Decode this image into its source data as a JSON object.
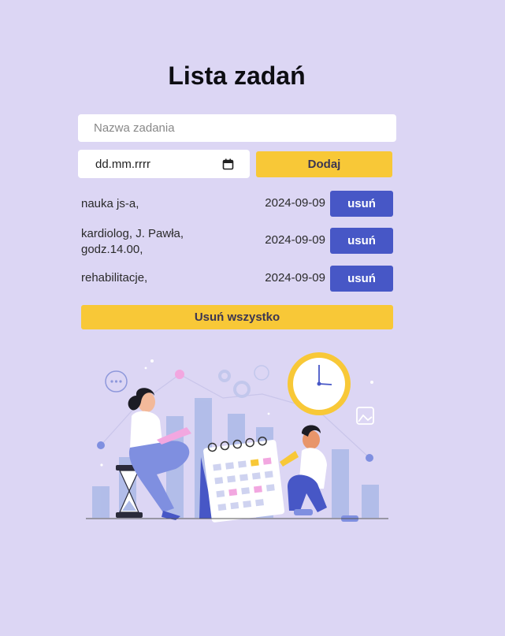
{
  "header": {
    "title": "Lista zadań"
  },
  "form": {
    "name_placeholder": "Nazwa zadania",
    "date_placeholder": "dd.mm.rrrr",
    "add_label": "Dodaj"
  },
  "tasks": [
    {
      "name": "nauka js-a,",
      "date": "2024-09-09",
      "delete_label": "usuń"
    },
    {
      "name_line1": "kardiolog, J. Pawła,",
      "name_line2": "godz.14.00,",
      "date": "2024-09-09",
      "delete_label": "usuń"
    },
    {
      "name": "rehabilitacje,",
      "date": "2024-09-09",
      "delete_label": "usuń"
    }
  ],
  "clear_all_label": "Usuń wszystko",
  "icons": {
    "date_picker": "calendar-icon"
  },
  "colors": {
    "background": "#dcd6f4",
    "accent_yellow": "#f8c837",
    "accent_blue": "#4757c6"
  }
}
